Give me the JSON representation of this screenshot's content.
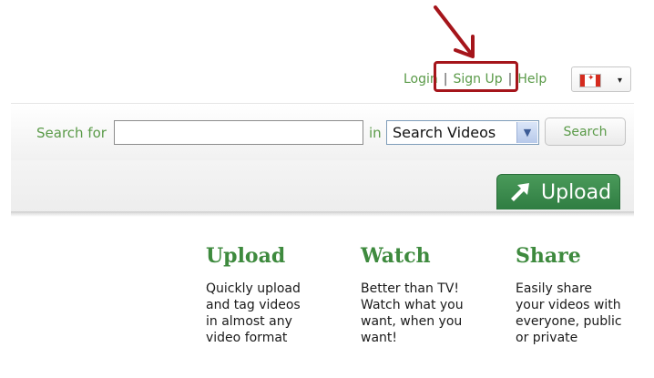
{
  "header": {
    "login_label": "Login",
    "separator": "|",
    "signup_label": "Sign Up",
    "help_label": "Help",
    "language": {
      "icon": "canada-flag-icon",
      "caret": "▾"
    }
  },
  "search": {
    "label": "Search for",
    "input_value": "",
    "in_label": "in",
    "scope_selected": "Search Videos",
    "button_label": "Search"
  },
  "upload": {
    "button_label": "Upload",
    "icon": "upload-arrow-icon"
  },
  "features": [
    {
      "title": "Upload",
      "text": "Quickly upload\nand tag videos\nin almost any\nvideo format"
    },
    {
      "title": "Watch",
      "text": "Better than TV!\nWatch what you\nwant, when you\nwant!"
    },
    {
      "title": "Share",
      "text": "Easily share\nyour videos with\neveryone, public\nor private"
    }
  ],
  "annotation": {
    "color": "#a5151b",
    "highlight_target": "Sign Up"
  },
  "colors": {
    "link_green": "#5a9a48",
    "heading_green": "#3e8a3e",
    "upload_green": "#2f7d42"
  }
}
